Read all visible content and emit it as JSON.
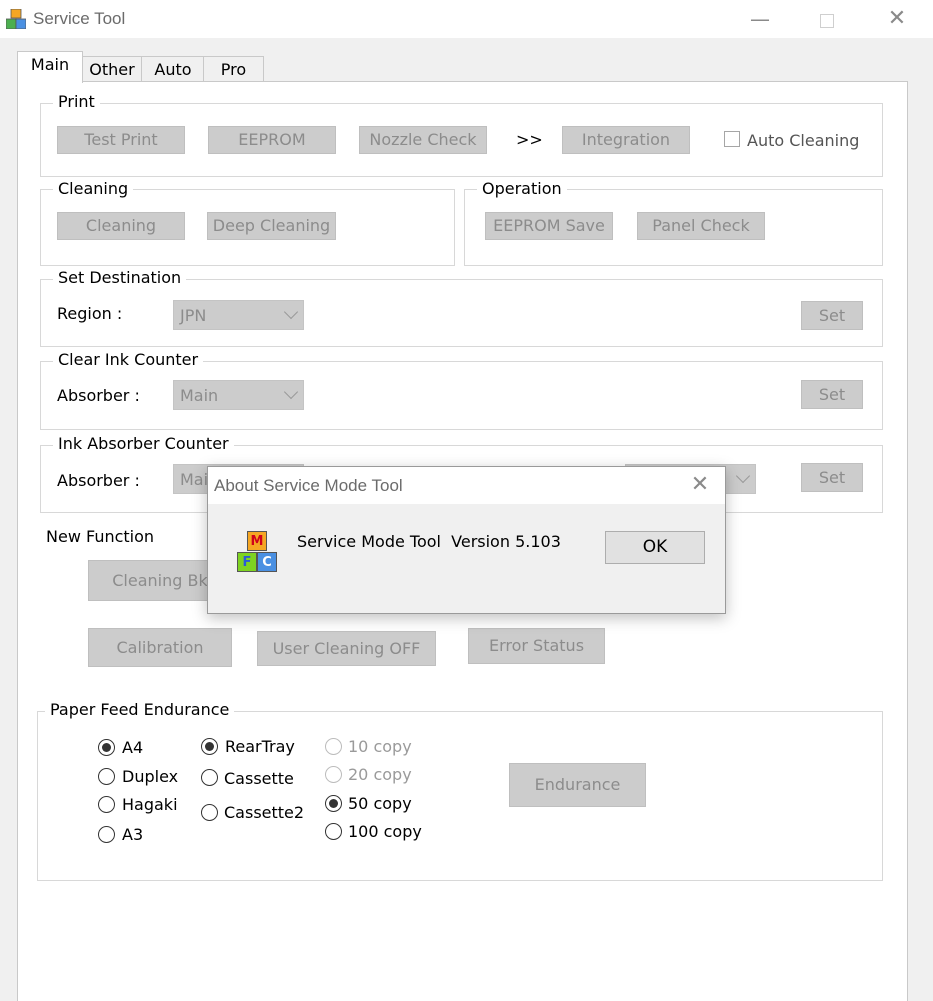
{
  "window": {
    "title": "Service Tool",
    "min_icon": "minimize-icon",
    "max_icon": "maximize-icon",
    "close_icon": "close-icon"
  },
  "tabs": [
    {
      "label": "Main",
      "active": true
    },
    {
      "label": "Other",
      "active": false
    },
    {
      "label": "Auto",
      "active": false
    },
    {
      "label": "Pro",
      "active": false
    }
  ],
  "print": {
    "legend": "Print",
    "test_print": "Test Print",
    "eeprom": "EEPROM",
    "nozzle_check": "Nozzle Check",
    "arrow": ">>",
    "integration": "Integration",
    "auto_cleaning": "Auto Cleaning",
    "auto_cleaning_checked": false
  },
  "cleaning": {
    "legend": "Cleaning",
    "cleaning": "Cleaning",
    "deep_cleaning": "Deep Cleaning"
  },
  "operation": {
    "legend": "Operation",
    "eeprom_save": "EEPROM Save",
    "panel_check": "Panel Check"
  },
  "set_destination": {
    "legend": "Set Destination",
    "label": "Region :",
    "value": "JPN",
    "set": "Set"
  },
  "clear_ink_counter": {
    "legend": "Clear Ink Counter",
    "label": "Absorber :",
    "value": "Main",
    "set": "Set"
  },
  "ink_absorber_counter": {
    "legend": "Ink Absorber Counter",
    "label": "Absorber :",
    "value": "Main",
    "set": "Set"
  },
  "new_function": {
    "legend": "New Function",
    "cleaning_bk": "Cleaning Bk",
    "calibration": "Calibration",
    "user_cleaning_off": "User Cleaning OFF",
    "error_status": "Error Status"
  },
  "paper_feed": {
    "legend": "Paper Feed Endurance",
    "paper": [
      {
        "label": "A4",
        "checked": true
      },
      {
        "label": "Duplex",
        "checked": false
      },
      {
        "label": "Hagaki",
        "checked": false
      },
      {
        "label": "A3",
        "checked": false
      }
    ],
    "source": [
      {
        "label": "RearTray",
        "checked": true
      },
      {
        "label": "Cassette",
        "checked": false
      },
      {
        "label": "Cassette2",
        "checked": false
      }
    ],
    "copies": [
      {
        "label": "10 copy",
        "checked": false,
        "disabled": true
      },
      {
        "label": "20 copy",
        "checked": false,
        "disabled": true
      },
      {
        "label": "50 copy",
        "checked": true,
        "disabled": false
      },
      {
        "label": "100 copy",
        "checked": false,
        "disabled": false
      }
    ],
    "endurance": "Endurance"
  },
  "dialog": {
    "title": "About Service Mode Tool",
    "message": "Service Mode Tool  Version 5.103",
    "ok": "OK",
    "icon": "mfc-blocks-icon",
    "icon_letters": [
      "M",
      "F",
      "C"
    ]
  }
}
